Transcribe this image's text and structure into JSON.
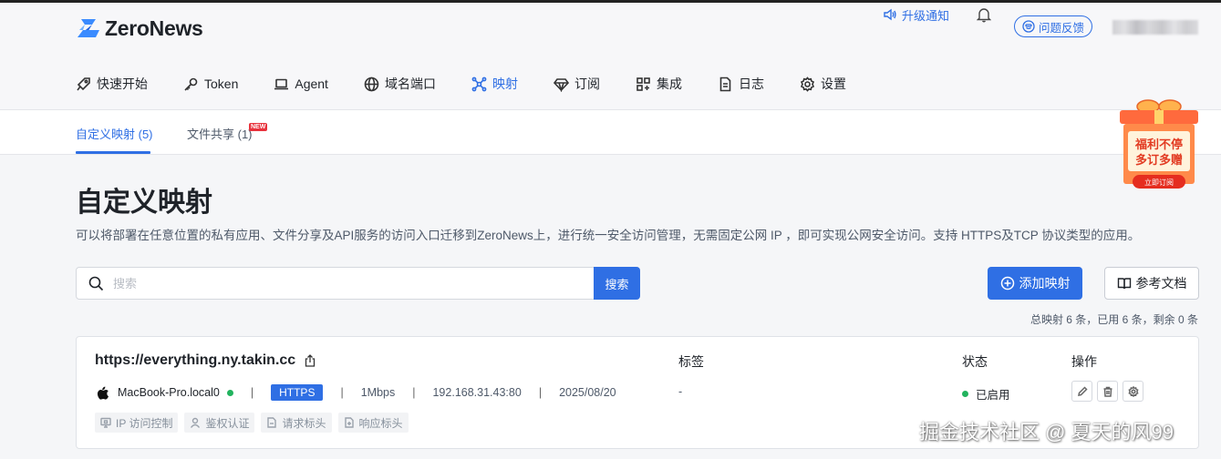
{
  "brand": {
    "name": "ZeroNews",
    "accent": "#2f6fe4"
  },
  "header": {
    "upgrade_label": "升级通知",
    "feedback_label": "问题反馈"
  },
  "nav": {
    "items": [
      {
        "label": "快速开始",
        "icon": "rocket-icon"
      },
      {
        "label": "Token",
        "icon": "key-icon"
      },
      {
        "label": "Agent",
        "icon": "laptop-icon"
      },
      {
        "label": "域名端口",
        "icon": "globe-icon"
      },
      {
        "label": "映射",
        "icon": "network-icon",
        "active": true
      },
      {
        "label": "订阅",
        "icon": "diamond-icon"
      },
      {
        "label": "集成",
        "icon": "grid-icon"
      },
      {
        "label": "日志",
        "icon": "document-icon"
      },
      {
        "label": "设置",
        "icon": "gear-icon"
      }
    ]
  },
  "subtabs": {
    "custom_mapping": "自定义映射 (5)",
    "file_share": "文件共享 (1)",
    "new_badge": "NEW"
  },
  "promo": {
    "line1": "福利不停",
    "line2": "多订多赠",
    "button": "立即订阅"
  },
  "page": {
    "title": "自定义映射",
    "description": "可以将部署在任意位置的私有应用、文件分享及API服务的访问入口迁移到ZeroNews上，进行统一安全访问管理，无需固定公网 IP ，即可实现公网安全访问。支持 HTTPS及TCP 协议类型的应用。"
  },
  "search": {
    "placeholder": "搜索",
    "value": "",
    "button": "搜索"
  },
  "actions": {
    "add_mapping": "添加映射",
    "reference_docs": "参考文档"
  },
  "summary": "总映射 6 条，已用 6 条，剩余 0 条",
  "mapping": {
    "url": "https://everything.ny.takin.cc",
    "columns": {
      "tags": "标签",
      "status": "状态",
      "ops": "操作"
    },
    "device": "MacBook-Pro.local0",
    "protocol": "HTTPS",
    "bandwidth": "1Mbps",
    "address": "192.168.31.43:80",
    "date": "2025/08/20",
    "tags": "-",
    "status": "已启用",
    "separator": "|",
    "features": [
      "IP 访问控制",
      "鉴权认证",
      "请求标头",
      "响应标头"
    ]
  },
  "watermark": "掘金技术社区 @ 夏天的风99"
}
